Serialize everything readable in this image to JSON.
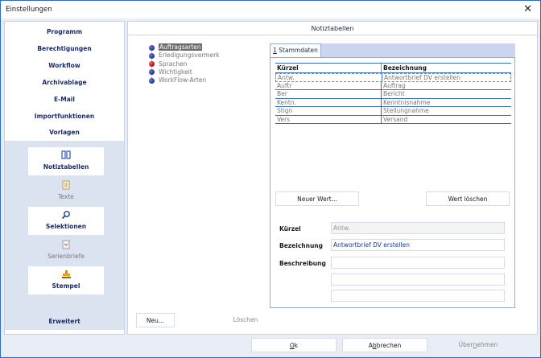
{
  "window": {
    "title": "Einstellungen",
    "close_glyph": "✕"
  },
  "sidebar": {
    "items": [
      {
        "label": "Programm"
      },
      {
        "label": "Berechtigungen"
      },
      {
        "label": "Workflow"
      },
      {
        "label": "Archivablage"
      },
      {
        "label": "E-Mail"
      },
      {
        "label": "Importfunktionen"
      },
      {
        "label": "Vorlagen"
      }
    ],
    "tiles": [
      {
        "label": "Notiztabellen",
        "icon": "table-columns-icon",
        "active": true
      },
      {
        "label": "Texte",
        "icon": "document-icon",
        "active": false
      },
      {
        "label": "Selektionen",
        "icon": "magnifier-icon",
        "active": true
      },
      {
        "label": "Serienbriefe",
        "icon": "letter-icon",
        "active": false
      },
      {
        "label": "Stempel",
        "icon": "stamp-icon",
        "active": true
      }
    ],
    "advanced_label": "Erweitert"
  },
  "main": {
    "header": "Notiztabellen",
    "tree": [
      {
        "label": "Auftragsarten",
        "color": "blue",
        "selected": true
      },
      {
        "label": "Erledigungsvermerk",
        "color": "blue",
        "selected": false
      },
      {
        "label": "Sprachen",
        "color": "red",
        "selected": false
      },
      {
        "label": "Wichtigkeit",
        "color": "blue",
        "selected": false
      },
      {
        "label": "WorkFlow-Arten",
        "color": "blue",
        "selected": false
      }
    ],
    "tab": {
      "number": "1",
      "label": " Stammdaten"
    },
    "grid": {
      "columns": [
        "Kürzel",
        "Bezeichnung"
      ],
      "rows": [
        [
          "Antw.",
          "Antwortbrief DV erstellen"
        ],
        [
          "Auftr",
          "Auftrag"
        ],
        [
          "Ber",
          "Bericht"
        ],
        [
          "Kentn.",
          "Kenntnisnahme"
        ],
        [
          "Stign",
          "Stellungnahme"
        ],
        [
          "Vers",
          "Versand"
        ]
      ]
    },
    "new_value_button": "Neuer Wert...",
    "delete_value_button": "Wert löschen",
    "form": {
      "kuerzel_label": "Kürzel",
      "kuerzel_value": "Antw.",
      "bezeichnung_label": "Bezeichnung",
      "bezeichnung_value": "Antwortbrief DV erstellen",
      "beschreibung_label": "Beschreibung"
    },
    "new_button": "Neu...",
    "delete_button": "Löschen"
  },
  "footer": {
    "ok": {
      "mnemonic": "O",
      "rest": "k"
    },
    "cancel": {
      "pre": "A",
      "mnemonic": "b",
      "rest": "brechen"
    },
    "apply": {
      "pre": "Über",
      "mnemonic": "n",
      "rest": "ehmen"
    }
  },
  "colors": {
    "accent": "#1b2e6b",
    "frame": "#2d6bd0",
    "panel": "#dbe3f1",
    "grid_line": "#3b6fb5"
  }
}
